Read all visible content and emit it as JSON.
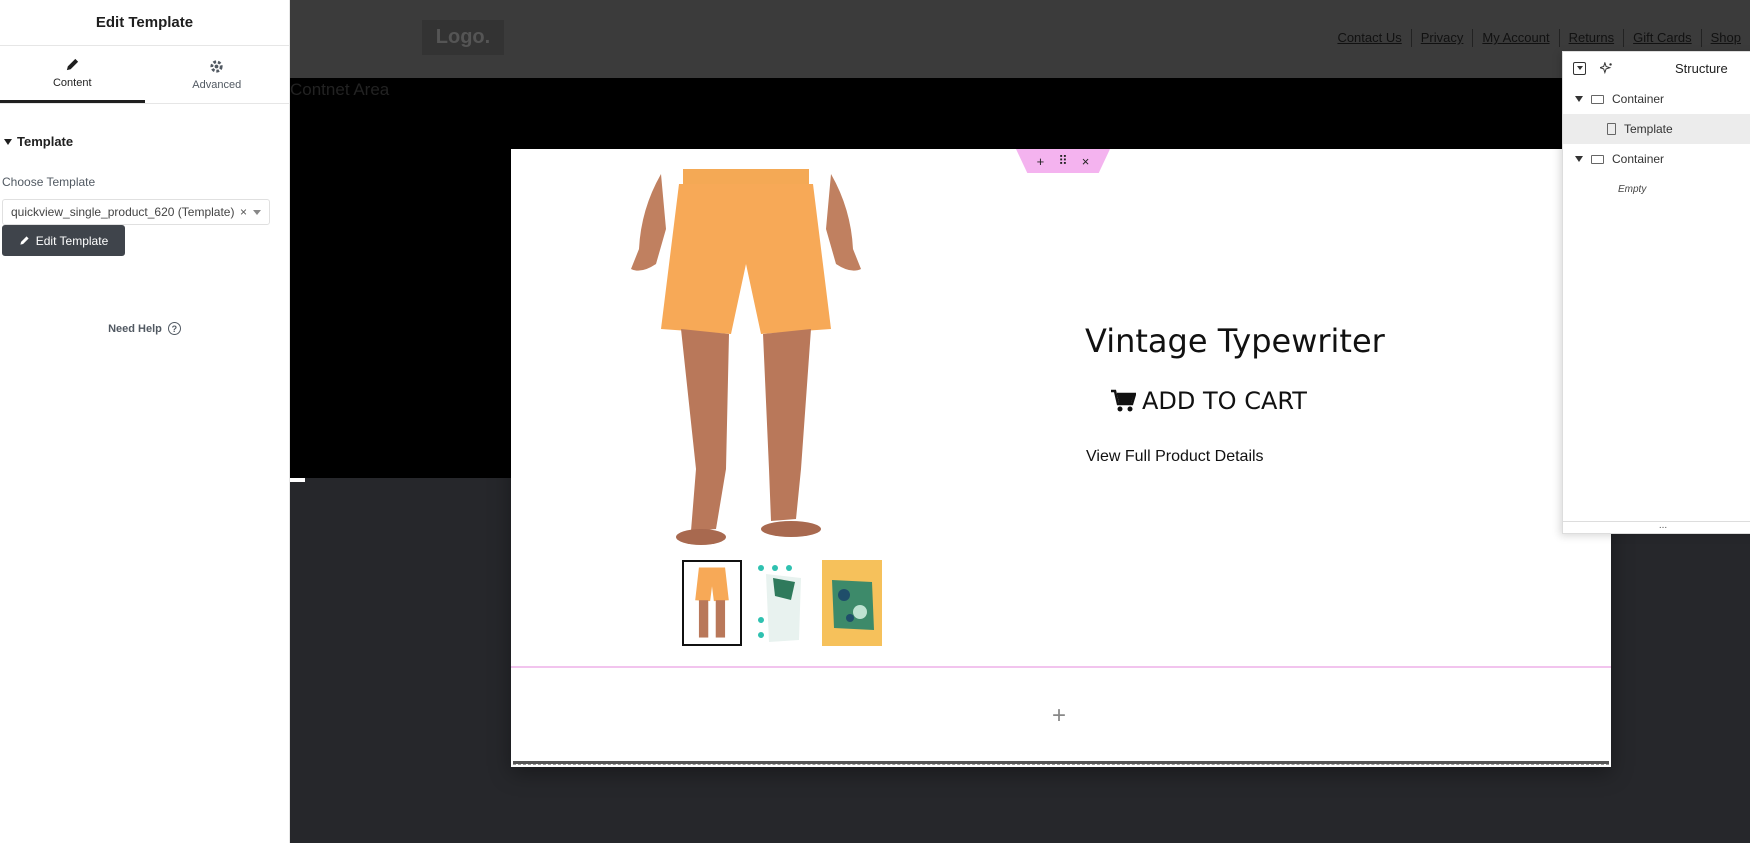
{
  "panel": {
    "title": "Edit Template",
    "tabs": [
      {
        "label": "Content",
        "icon": "pencil-icon"
      },
      {
        "label": "Advanced",
        "icon": "gear-icon"
      }
    ],
    "section_title": "Template",
    "choose_label": "Choose Template",
    "selected_template": "quickview_single_product_620 (Template)",
    "clear_symbol": "×",
    "edit_button": "Edit Template",
    "need_help": "Need Help",
    "help_symbol": "?",
    "collapse_symbol": "‹"
  },
  "site": {
    "logo": "Logo.",
    "nav": [
      "Contact Us",
      "Privacy",
      "My Account",
      "Returns",
      "Gift Cards",
      "Shop"
    ],
    "content_area_label": "Contnet Area"
  },
  "modal": {
    "handle": {
      "add": "+",
      "move": "⠿",
      "close": "×"
    },
    "product_title": "Vintage Typewriter",
    "add_to_cart": "ADD TO CART",
    "full_details": "View Full Product Details",
    "add_section": "+"
  },
  "structure": {
    "title": "Structure",
    "items": [
      {
        "label": "Container"
      },
      {
        "label": "Template"
      },
      {
        "label": "Container"
      }
    ],
    "empty_label": "Empty",
    "footer": "..."
  },
  "colors": {
    "accent": "#f4b3ef",
    "button": "#3f444b",
    "canvas": "#26272b"
  }
}
